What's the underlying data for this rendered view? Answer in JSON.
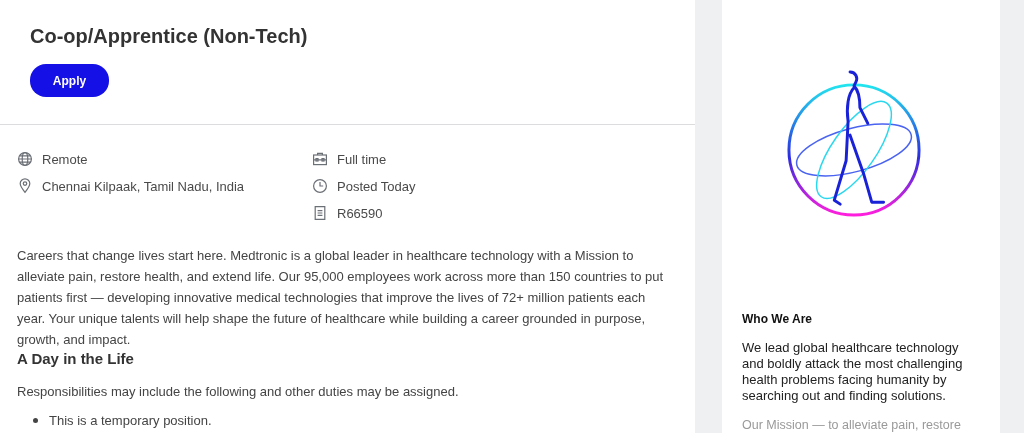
{
  "job": {
    "title": "Co-op/Apprentice (Non-Tech)",
    "apply_button": "Apply"
  },
  "location_details": [
    {
      "kind": "globe",
      "text": "Remote"
    },
    {
      "kind": "pin",
      "text": "Chennai Kilpaak, Tamil Nadu, India"
    }
  ],
  "job_details": [
    {
      "kind": "briefcase",
      "text": "Full time"
    },
    {
      "kind": "clock",
      "text": "Posted Today"
    },
    {
      "kind": "document",
      "text": "R66590"
    }
  ],
  "description": {
    "intro": "Careers that change lives start here. Medtronic is a global leader in healthcare technology with a Mission to alleviate pain, restore health, and extend life. Our 95,000 employees work across more than 150 countries to put patients first — developing innovative medical technologies that improve the lives of 72+ million patients each year. Your unique talents will help shape the future of healthcare while building a career grounded in purpose, growth, and impact.",
    "heading": "A Day in the Life",
    "lead": "Responsibilities may include the following and other duties may be assigned.",
    "bullets": [
      "This is a temporary position."
    ]
  },
  "sidebar": {
    "heading": "Who We Are",
    "text": "We lead global healthcare technology and boldly attack the most challenging health problems facing humanity by searching out and finding solutions.",
    "more": "Our Mission — to alleviate pain, restore"
  }
}
